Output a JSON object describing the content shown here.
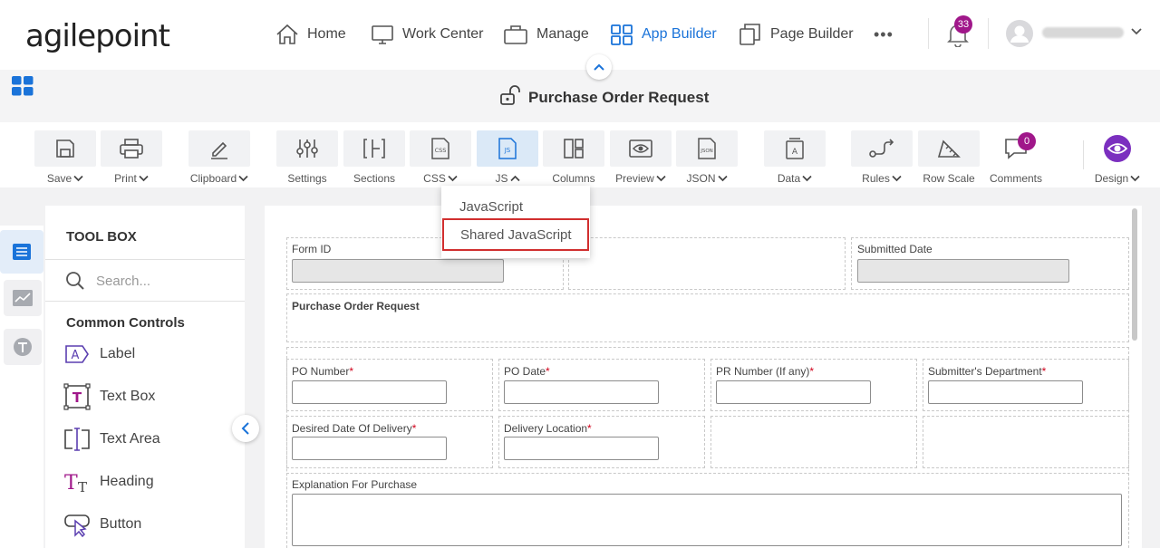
{
  "nav": {
    "logo": "agilepoint",
    "items": [
      {
        "label": "Home",
        "icon": "home-icon"
      },
      {
        "label": "Work Center",
        "icon": "monitor-icon"
      },
      {
        "label": "Manage",
        "icon": "briefcase-icon"
      },
      {
        "label": "App Builder",
        "icon": "grid-icon"
      },
      {
        "label": "Page Builder",
        "icon": "pages-icon"
      }
    ],
    "more_label": "•••",
    "notification_count": "33",
    "accent_color": "#1a73d9",
    "badge_color": "#a0178a"
  },
  "header": {
    "title": "Purchase Order Request"
  },
  "toolbar": {
    "items": [
      {
        "label": "Save",
        "icon": "save-icon",
        "caret": "down"
      },
      {
        "label": "Print",
        "icon": "print-icon",
        "caret": "down"
      },
      {
        "label": "Clipboard",
        "icon": "pencil-icon",
        "caret": "down"
      },
      {
        "label": "Settings",
        "icon": "sliders-icon"
      },
      {
        "label": "Sections",
        "icon": "sections-icon"
      },
      {
        "label": "CSS",
        "icon": "css-file-icon",
        "caret": "down"
      },
      {
        "label": "JS",
        "icon": "js-file-icon",
        "caret": "up"
      },
      {
        "label": "Columns",
        "icon": "columns-icon"
      },
      {
        "label": "Preview",
        "icon": "eye-icon",
        "caret": "down"
      },
      {
        "label": "JSON",
        "icon": "json-file-icon",
        "caret": "down"
      },
      {
        "label": "Data",
        "icon": "data-icon",
        "caret": "down"
      },
      {
        "label": "Rules",
        "icon": "rules-icon",
        "caret": "down"
      },
      {
        "label": "Row Scale",
        "icon": "ruler-icon"
      },
      {
        "label": "Comments",
        "icon": "comment-icon"
      },
      {
        "label": "Design",
        "icon": "design-eye-icon",
        "caret": "down"
      }
    ],
    "comments_count": "0"
  },
  "js_menu": {
    "items": [
      "JavaScript",
      "Shared JavaScript"
    ]
  },
  "toolbox": {
    "title": "TOOL BOX",
    "search_placeholder": "Search...",
    "section": "Common Controls",
    "controls": [
      {
        "label": "Label",
        "icon": "label-icon"
      },
      {
        "label": "Text Box",
        "icon": "textbox-icon"
      },
      {
        "label": "Text Area",
        "icon": "textarea-icon"
      },
      {
        "label": "Heading",
        "icon": "heading-icon"
      },
      {
        "label": "Button",
        "icon": "button-icon"
      }
    ]
  },
  "form": {
    "form_id_label": "Form ID",
    "submitted_date_label": "Submitted Date",
    "heading": "Purchase Order Request",
    "po_number_label": "PO Number",
    "po_date_label": "PO Date",
    "pr_number_label": "PR Number (If any)",
    "department_label": "Submitter's Department",
    "delivery_date_label": "Desired Date Of Delivery",
    "delivery_location_label": "Delivery Location",
    "explanation_label": "Explanation For Purchase",
    "required_mark": "*"
  }
}
